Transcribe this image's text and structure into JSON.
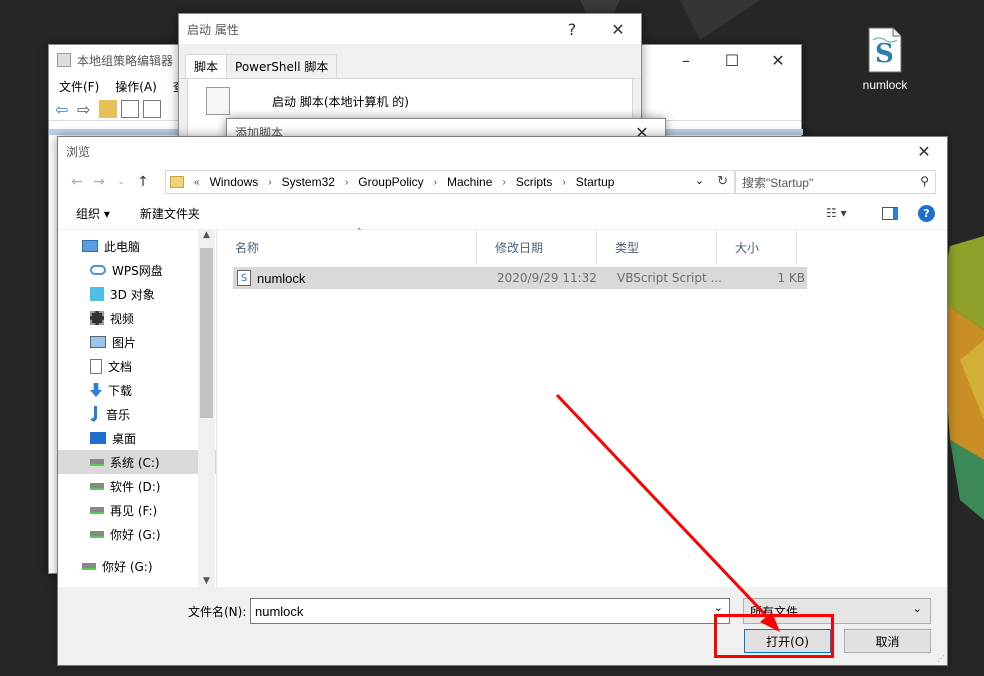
{
  "desktop": {
    "file_icon_label": "numlock"
  },
  "gpedit": {
    "title": "本地组策略编辑器",
    "menu": [
      "文件(F)",
      "操作(A)",
      "查"
    ]
  },
  "startup_props": {
    "title": "启动 属性",
    "help": "?",
    "tabs": [
      "脚本",
      "PowerShell 脚本"
    ],
    "desc": "启动 脚本(本地计算机 的)"
  },
  "add_script": {
    "title": "添加脚本"
  },
  "browse": {
    "title": "浏览",
    "breadcrumb_prefix": "«",
    "breadcrumb": [
      "Windows",
      "System32",
      "GroupPolicy",
      "Machine",
      "Scripts",
      "Startup"
    ],
    "search_placeholder": "搜索\"Startup\"",
    "cmd_organize": "组织 ▾",
    "cmd_new_folder": "新建文件夹",
    "nav_items": [
      {
        "label": "此电脑",
        "icon": "computer-icon"
      },
      {
        "label": "WPS网盘",
        "icon": "cloud-icon"
      },
      {
        "label": "3D 对象",
        "icon": "cube-icon"
      },
      {
        "label": "视频",
        "icon": "video-icon"
      },
      {
        "label": "图片",
        "icon": "picture-icon"
      },
      {
        "label": "文档",
        "icon": "document-icon"
      },
      {
        "label": "下载",
        "icon": "download-icon"
      },
      {
        "label": "音乐",
        "icon": "music-icon"
      },
      {
        "label": "桌面",
        "icon": "desktop-icon"
      },
      {
        "label": "系统 (C:)",
        "icon": "drive-icon"
      },
      {
        "label": "软件 (D:)",
        "icon": "drive-icon"
      },
      {
        "label": "再见 (F:)",
        "icon": "drive-icon"
      },
      {
        "label": "你好 (G:)",
        "icon": "drive-icon"
      },
      {
        "label": "你好 (G:)",
        "icon": "drive-icon"
      }
    ],
    "columns": [
      "名称",
      "修改日期",
      "类型",
      "大小"
    ],
    "files": [
      {
        "name": "numlock",
        "modified": "2020/9/29 11:32",
        "type": "VBScript Script ...",
        "size": "1 KB"
      }
    ],
    "filename_label": "文件名(N):",
    "filename_value": "numlock",
    "filetype": "所有文件",
    "open_label": "打开(O)",
    "cancel_label": "取消"
  },
  "colors": {
    "annotation": "#ff0000",
    "accent": "#0078d7"
  }
}
